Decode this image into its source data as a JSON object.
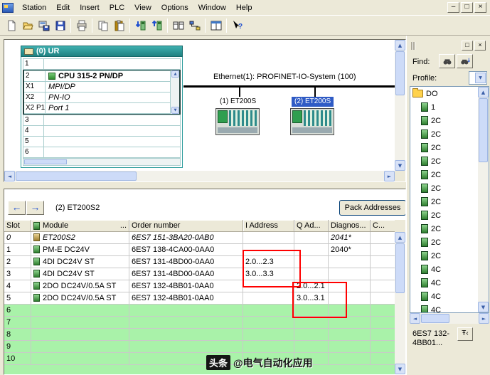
{
  "icons": {
    "minimize": "–",
    "restore": "□",
    "close": "×",
    "up": "▲",
    "down": "▼",
    "left": "◄",
    "right": "►",
    "back": "←",
    "forward": "→",
    "dropdown": "▼",
    "info": "Ŧ‹"
  },
  "menubar": {
    "items": [
      "Station",
      "Edit",
      "Insert",
      "PLC",
      "View",
      "Options",
      "Window",
      "Help"
    ]
  },
  "toolbar": {
    "buttons": [
      "new-station",
      "open-station",
      "save-and-compile",
      "save",
      "print",
      "copy",
      "paste",
      "download-to-module",
      "upload-from-module",
      "station-configuration",
      "network-view",
      "split-view",
      "help"
    ]
  },
  "rack": {
    "title": "(0) UR",
    "rows": [
      {
        "slot": "1",
        "label": ""
      },
      {
        "slot": "2",
        "label": "CPU 315-2 PN/DP"
      },
      {
        "slot": "X1",
        "label": "MPI/DP"
      },
      {
        "slot": "X2",
        "label": "PN-IO"
      },
      {
        "slot": "X2 P1",
        "label": "Port 1"
      },
      {
        "slot": "3",
        "label": ""
      },
      {
        "slot": "4",
        "label": ""
      },
      {
        "slot": "5",
        "label": ""
      },
      {
        "slot": "6",
        "label": ""
      }
    ]
  },
  "network": {
    "bus_label": "Ethernet(1): PROFINET-IO-System (100)",
    "devices": [
      {
        "label": "(1) ET200S"
      },
      {
        "label": "(2) ET200S"
      }
    ]
  },
  "io_table": {
    "nav_title": "(2) ET200S2",
    "pack_button": "Pack Addresses",
    "columns": [
      {
        "label": "Slot"
      },
      {
        "label": "Module",
        "suffix": "..."
      },
      {
        "label": "Order number"
      },
      {
        "label": "I Address"
      },
      {
        "label": "Q Ad..."
      },
      {
        "label": "Diagnos..."
      },
      {
        "label": "C..."
      }
    ],
    "rows": [
      {
        "slot": "0",
        "module": "ET200S2",
        "order": "6ES7 151-3BA20-0AB0",
        "i": "",
        "q": "",
        "diag": "2041*"
      },
      {
        "slot": "1",
        "module": "PM-E DC24V",
        "order": "6ES7 138-4CA00-0AA0",
        "i": "",
        "q": "",
        "diag": "2040*"
      },
      {
        "slot": "2",
        "module": "4DI DC24V ST",
        "order": "6ES7 131-4BD00-0AA0",
        "i": "2.0...2.3",
        "q": "",
        "diag": ""
      },
      {
        "slot": "3",
        "module": "4DI DC24V ST",
        "order": "6ES7 131-4BD00-0AA0",
        "i": "3.0...3.3",
        "q": "",
        "diag": ""
      },
      {
        "slot": "4",
        "module": "2DO DC24V/0.5A ST",
        "order": "6ES7 132-4BB01-0AA0",
        "i": "",
        "q": "2.0...2.1",
        "diag": ""
      },
      {
        "slot": "5",
        "module": "2DO DC24V/0.5A ST",
        "order": "6ES7 132-4BB01-0AA0",
        "i": "",
        "q": "3.0...3.1",
        "diag": ""
      },
      {
        "slot": "6",
        "module": "",
        "order": "",
        "i": "",
        "q": "",
        "diag": ""
      },
      {
        "slot": "7",
        "module": "",
        "order": "",
        "i": "",
        "q": "",
        "diag": ""
      },
      {
        "slot": "8",
        "module": "",
        "order": "",
        "i": "",
        "q": "",
        "diag": ""
      },
      {
        "slot": "9",
        "module": "",
        "order": "",
        "i": "",
        "q": "",
        "diag": ""
      },
      {
        "slot": "10",
        "module": "",
        "order": "",
        "i": "",
        "q": "",
        "diag": ""
      }
    ]
  },
  "catalog": {
    "find_label": "Find:",
    "profile_label": "Profile:",
    "tree": {
      "folder": "DO",
      "items": [
        "1",
        "2C",
        "2C",
        "2C",
        "2C",
        "2C",
        "2C",
        "2C",
        "2C",
        "2C",
        "2C",
        "2C",
        "4C",
        "4C",
        "4C",
        "4C"
      ]
    },
    "info_text": "6ES7 132-4BB01..."
  },
  "watermark": {
    "badge": "头条",
    "text": "@电气自动化应用"
  }
}
